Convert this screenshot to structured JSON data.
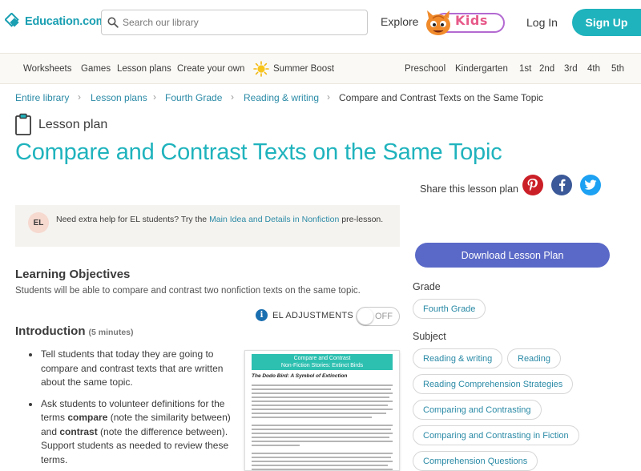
{
  "header": {
    "logo_text": "Education.com",
    "search_placeholder": "Search our library",
    "explore_label": "Explore",
    "kids_label": "Kids",
    "login_label": "Log In",
    "signup_label": "Sign Up"
  },
  "nav": {
    "left": [
      "Worksheets",
      "Games",
      "Lesson plans",
      "Create your own",
      "Summer Boost"
    ],
    "grades": [
      "Preschool",
      "Kindergarten",
      "1st",
      "2nd",
      "3rd",
      "4th",
      "5th"
    ]
  },
  "breadcrumb": [
    "Entire library",
    "Lesson plans",
    "Fourth Grade",
    "Reading & writing",
    "Compare and Contrast Texts on the Same Topic"
  ],
  "page": {
    "type_label": "Lesson plan",
    "title": "Compare and Contrast Texts on the Same Topic",
    "share_label": "Share this lesson plan"
  },
  "el_note": {
    "badge": "EL",
    "text_before": "Need extra help for EL students? Try the ",
    "link": "Main Idea and Details in Nonfiction",
    "text_after": " pre-lesson."
  },
  "objectives": {
    "heading": "Learning Objectives",
    "text": "Students will be able to compare and contrast two nonfiction texts on the same topic."
  },
  "el_adjustments": {
    "label": "EL ADJUSTMENTS",
    "toggle": "OFF"
  },
  "introduction": {
    "heading": "Introduction",
    "duration": "(5 minutes)",
    "bullet1": "Tell students that today they are going to compare and contrast texts that are written about the same topic.",
    "b2_part1": "Ask students to volunteer definitions for the terms ",
    "b2_bold1": "compare",
    "b2_part2": " (note the similarity between) and ",
    "b2_bold2": "contrast",
    "b2_part3": " (note the difference between). Support students as needed to review these terms."
  },
  "worksheet": {
    "banner_line1": "Compare and Contrast",
    "banner_line2": "Non-Fiction Stories: Extinct Birds",
    "subtitle": "The Dodo Bird: A Symbol of Extinction"
  },
  "sidebar": {
    "download_label": "Download Lesson Plan",
    "grade_heading": "Grade",
    "grade_tags": [
      "Fourth Grade"
    ],
    "subject_heading": "Subject",
    "subject_tags": [
      "Reading & writing",
      "Reading",
      "Reading Comprehension Strategies",
      "Comparing and Contrasting",
      "Comparing and Contrasting in Fiction",
      "Comprehension Questions"
    ]
  },
  "colors": {
    "brand_teal": "#1fb3bd",
    "link_blue": "#2a8aa6",
    "download_purple": "#5a69c7",
    "pinterest": "#cb1f27",
    "facebook": "#3b5998",
    "twitter": "#1da1f2"
  }
}
